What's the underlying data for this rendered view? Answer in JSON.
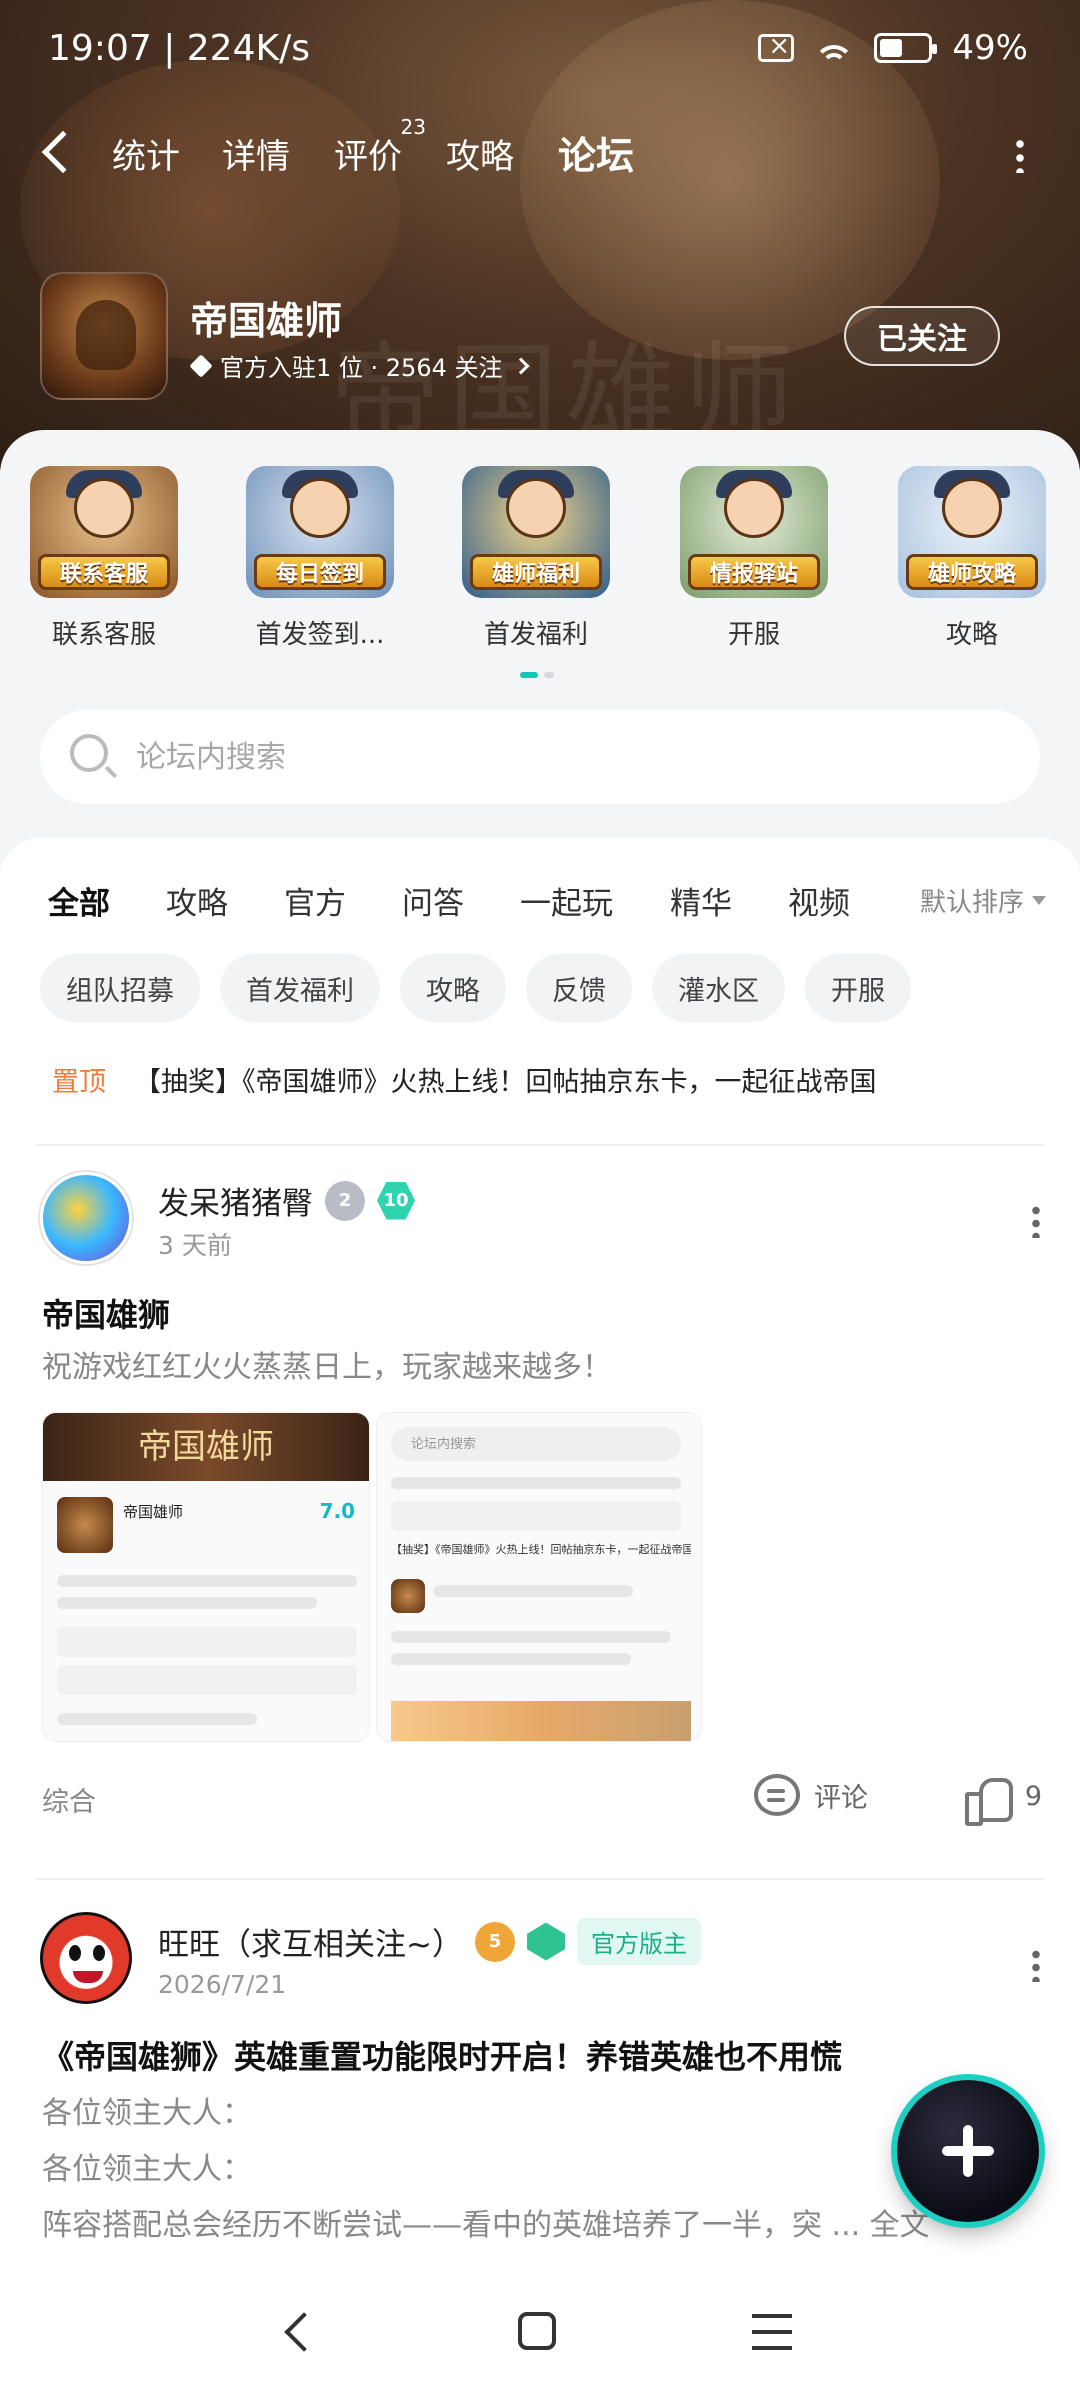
{
  "status": {
    "time": "19:07 | 224K/s",
    "battery": "49%"
  },
  "nav": {
    "tabs": [
      {
        "label": "统计"
      },
      {
        "label": "详情"
      },
      {
        "label": "评价",
        "badge": "23"
      },
      {
        "label": "攻略"
      },
      {
        "label": "论坛"
      }
    ],
    "active_tab": "论坛"
  },
  "game": {
    "title": "帝国雄师",
    "meta": "官方入驻1 位 · 2564 关注",
    "follow_label": "已关注",
    "watermark": "帝国雄师"
  },
  "shortcuts": [
    {
      "badge": "联系客服",
      "label": "联系客服",
      "color": "#c9864a"
    },
    {
      "badge": "每日签到",
      "label": "首发签到...",
      "color": "#6f8fb8"
    },
    {
      "badge": "雄师福利",
      "label": "首发福利",
      "color": "#2f5c8c"
    },
    {
      "badge": "情报驿站",
      "label": "开服",
      "color": "#7a9c6a"
    },
    {
      "badge": "雄师攻略",
      "label": "攻略",
      "color": "#a6c0de"
    }
  ],
  "search": {
    "placeholder": "论坛内搜索"
  },
  "categories": [
    "全部",
    "攻略",
    "官方",
    "问答",
    "一起玩",
    "精华",
    "视频"
  ],
  "active_category": "全部",
  "sort_label": "默认排序",
  "chips": [
    "组队招募",
    "首发福利",
    "攻略",
    "反馈",
    "灌水区",
    "开服"
  ],
  "pinned": {
    "tag": "置顶",
    "text": "【抽奖】《帝国雄师》火热上线！回帖抽京东卡，一起征战帝国"
  },
  "posts": [
    {
      "author": "发呆猪猪臀",
      "level_badge": "2",
      "score_badge": "10",
      "time": "3 天前",
      "title": "帝国雄狮",
      "body": [
        "祝游戏红红火火蒸蒸日上，玩家越来越多！"
      ],
      "shot1_title": "帝国雄师",
      "shot1_game": "帝国雄师",
      "shot1_score": "7.0",
      "shot2_search": "论坛内搜索",
      "shot2_pin": "【抽奖】《帝国雄师》火热上线！回帖抽京东卡，一起征战帝国",
      "category": "综合",
      "comment_label": "评论",
      "likes": "9"
    },
    {
      "author": "旺旺（求互相关注~）",
      "level_badge": "5",
      "mod_label": "官方版主",
      "time": "2026/7/21",
      "title": "《帝国雄狮》英雄重置功能限时开启！养错英雄也不用慌",
      "body": [
        "各位领主大人：",
        "各位领主大人：",
        "阵容搭配总会经历不断尝试——看中的英雄培养了一半，突 ... 全文"
      ]
    }
  ]
}
